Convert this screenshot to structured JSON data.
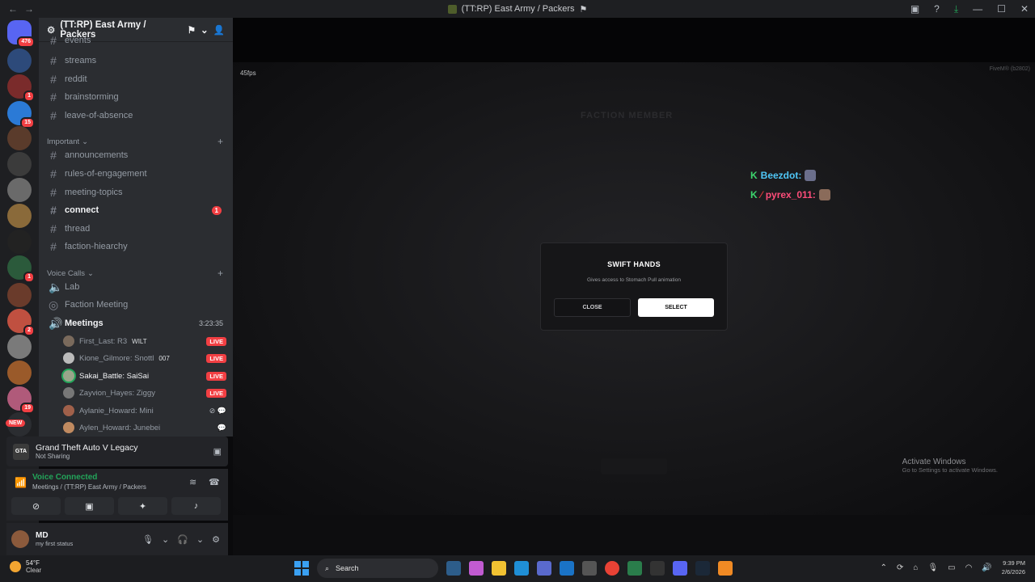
{
  "titlebar": {
    "title": "(TT:RP) East Army / Packers"
  },
  "guild": {
    "name": "(TT:RP) East Army / Packers"
  },
  "servers": [
    {
      "ping": "476",
      "color": "#5865f2"
    },
    {
      "ping": "",
      "color": "#2d4a7a"
    },
    {
      "ping": "1",
      "color": "#7a2b2b"
    },
    {
      "ping": "15",
      "color": "#2b7ad6"
    },
    {
      "ping": "",
      "color": "#5a3b2b"
    },
    {
      "ping": "",
      "color": "#3b3b3b"
    },
    {
      "ping": "",
      "color": "#6a6a6a"
    },
    {
      "ping": "",
      "color": "#8a6a3a"
    },
    {
      "ping": "",
      "color": "#222"
    },
    {
      "ping": "1",
      "color": "#2b5a3b"
    },
    {
      "ping": "",
      "color": "#6a3b2b"
    },
    {
      "ping": "2",
      "color": "#c05040"
    },
    {
      "ping": "",
      "color": "#7a7a7a"
    },
    {
      "ping": "",
      "color": "#9a5a2a"
    },
    {
      "ping": "19",
      "color": "#b05a7a"
    },
    {
      "ping": "",
      "new": "NEW",
      "color": "#2b2d31"
    }
  ],
  "channels": {
    "partial": "events",
    "top": [
      "streams",
      "reddit",
      "brainstorming",
      "leave-of-absence"
    ],
    "important_label": "Important",
    "important": [
      "announcements",
      "rules-of-engagement",
      "meeting-topics",
      "connect",
      "thread",
      "faction-hiearchy"
    ],
    "connect_count": "1",
    "voice_label": "Voice Calls",
    "voice": [
      "Lab",
      "Faction Meeting",
      "Meetings"
    ],
    "meetings_timer": "3:23:35"
  },
  "voice_users": [
    {
      "name": "First_Last: R3",
      "extra": "WILT",
      "live": "LIVE"
    },
    {
      "name": "Kione_Gilmore: Snottl",
      "extra": "007",
      "live": "LIVE"
    },
    {
      "name": "Sakai_Battle: SaiSai",
      "extra": "",
      "live": "LIVE"
    },
    {
      "name": "Zayvion_Hayes: Ziggy",
      "extra": "",
      "live": "LIVE"
    },
    {
      "name": "Aylanie_Howard: Mini",
      "extra": "",
      "live": ""
    },
    {
      "name": "Aylen_Howard: Junebei",
      "extra": "",
      "live": ""
    }
  ],
  "activity": {
    "game": "Grand Theft Auto V Legacy",
    "sub": "Not Sharing",
    "logo": "GTA"
  },
  "voice_panel": {
    "status": "Voice Connected",
    "where": "Meetings / (TT:RP) East Army / Packers"
  },
  "user": {
    "name": "MD",
    "status": "my first status"
  },
  "game": {
    "fps": "45fps",
    "build": "FiveM® (b2802)",
    "ghost_title": "FACTION MEMBER",
    "chat": [
      {
        "name": "Beezdot:"
      },
      {
        "name": "pyrex_011:"
      }
    ],
    "modal": {
      "title": "SWIFT HANDS",
      "desc": "Gives access to Stomach Pull animation",
      "close": "CLOSE",
      "select": "SELECT"
    },
    "activate_title": "Activate Windows",
    "activate_sub": "Go to Settings to activate Windows."
  },
  "taskbar": {
    "temp": "54°F",
    "weather": "Clear",
    "search": "Search",
    "time": "9:39 PM",
    "date": "2/6/2026"
  }
}
